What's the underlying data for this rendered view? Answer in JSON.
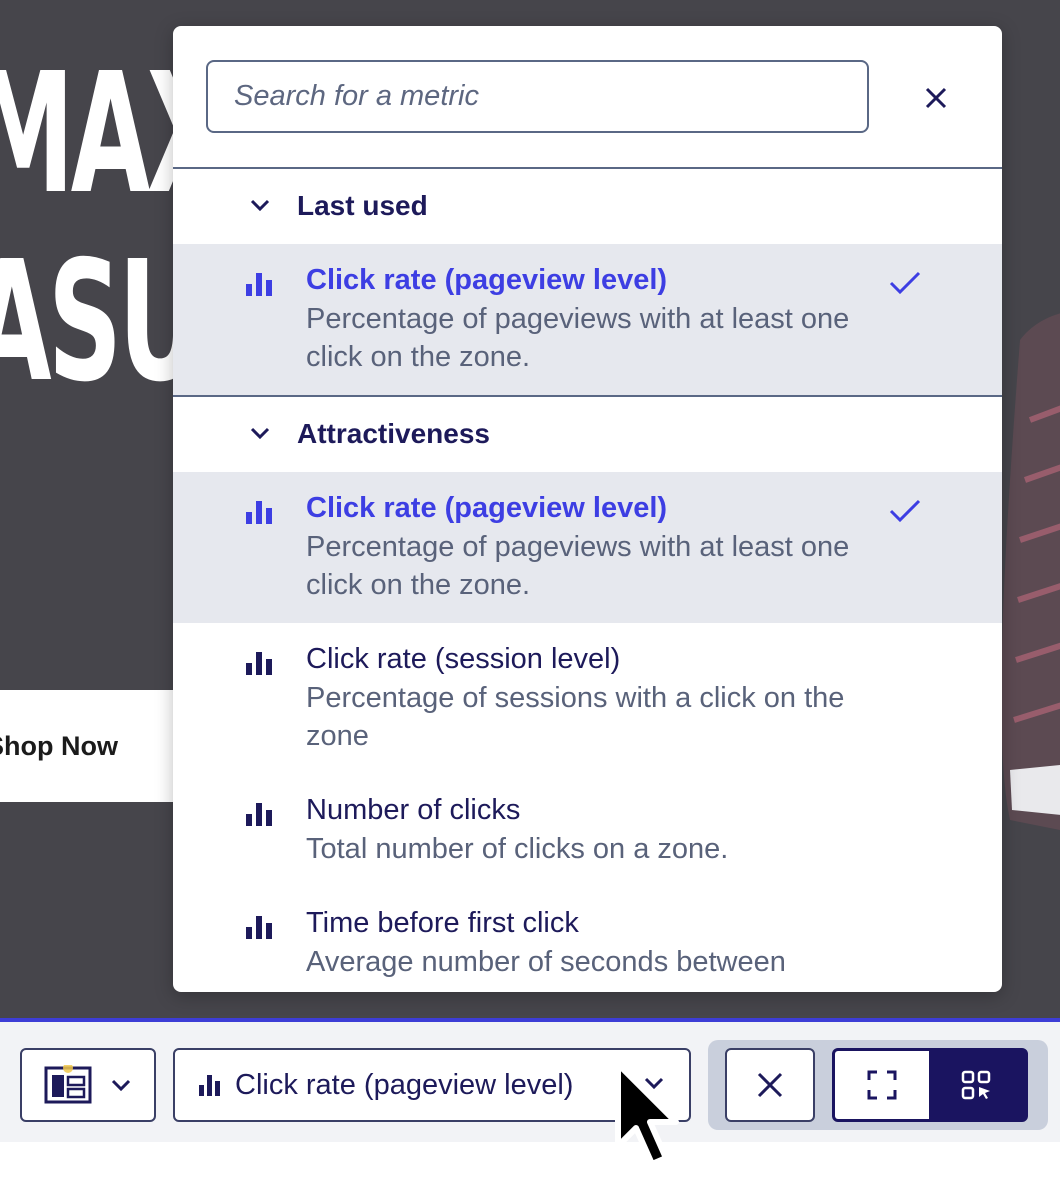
{
  "background": {
    "hero_line_1": "MAX",
    "hero_line_2": "ASU",
    "shop_button": "Shop Now"
  },
  "metric_picker": {
    "search_placeholder": "Search for a metric",
    "close_icon": "close-icon",
    "groups": [
      {
        "title": "Last used",
        "items": [
          {
            "title": "Click rate (pageview level)",
            "description": "Percentage of pageviews with at least one click on the zone.",
            "selected": true
          }
        ]
      },
      {
        "title": "Attractiveness",
        "items": [
          {
            "title": "Click rate (pageview level)",
            "description": "Percentage of pageviews with at least one click on the zone.",
            "selected": true
          },
          {
            "title": "Click rate (session level)",
            "description": "Percentage of sessions with a click on the zone",
            "selected": false
          },
          {
            "title": "Number of clicks",
            "description": "Total number of clicks on a zone.",
            "selected": false
          },
          {
            "title": "Time before first click",
            "description": "Average number of seconds between",
            "selected": false
          }
        ]
      }
    ]
  },
  "toolbar": {
    "selected_metric": "Click rate (pageview level)",
    "layout_icon": "layout-icon",
    "close_icon": "close-icon",
    "fullscreen_icon": "fullscreen-icon",
    "zone-select_icon": "zone-select-icon"
  },
  "colors": {
    "accent": "#3d3ee3",
    "navy": "#1a1460",
    "selected_row": "#e6e8ee",
    "background_page": "#46454b"
  }
}
